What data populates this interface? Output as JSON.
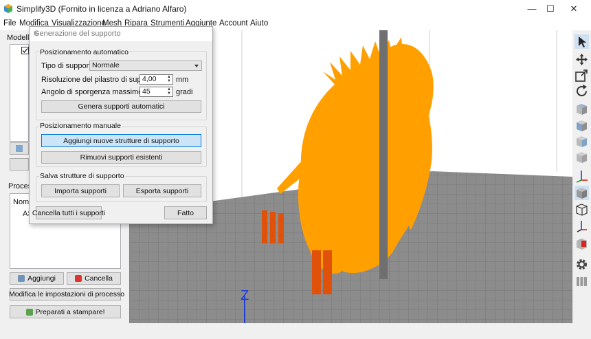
{
  "window": {
    "title": "Simplify3D (Fornito in licenza a Adriano Alfaro)",
    "minimize": "—",
    "maximize": "☐",
    "close": "✕"
  },
  "menu": [
    "File",
    "Modifica",
    "Visualizzazione",
    "Mesh",
    "Ripara",
    "Strumenti",
    "Aggiunte",
    "Account",
    "Aiuto"
  ],
  "left": {
    "models_label": "Modelli",
    "processes_label": "Processi",
    "process_list_header": "Nome",
    "process_item": "AS",
    "add_button": "Aggiungi",
    "delete_button": "Cancella",
    "edit_process_button": "Modifica le impostazioni di processo",
    "prepare_button": "Preparati a stampare!"
  },
  "dialog": {
    "title": "Generazione del supporto",
    "close": "×",
    "auto_group": "Posizionamento automatico",
    "support_type_label": "Tipo di supporto",
    "support_type_value": "Normale",
    "pillar_label": "Risoluzione del pilastro di supporto",
    "pillar_value": "4,00",
    "pillar_unit": "mm",
    "angle_label": "Angolo di sporgenza massimo",
    "angle_value": "45",
    "angle_unit": "gradi",
    "generate_button": "Genera supporti automatici",
    "manual_group": "Posizionamento manuale",
    "add_structures_button": "Aggiungi nuove strutture di supporto",
    "remove_button": "Rimuovi supporti esistenti",
    "save_group": "Salva strutture di supporto",
    "import_button": "Importa supporti",
    "export_button": "Esporta supporti",
    "cancel_all_button": "Cancella tutti i supporti",
    "done_button": "Fatto"
  },
  "viewport": {
    "axis_label": "Z",
    "model_color": "#ffa000",
    "support_color": "#e0520a",
    "bed_color": "#8c8c8c"
  },
  "toolbar_icons": [
    "select-arrow-icon",
    "move-icon",
    "scale-icon",
    "rotate-icon",
    "view-cube-top-icon",
    "view-cube-front-icon",
    "view-cube-side-icon",
    "view-cube-iso-icon",
    "axes-icon",
    "solid-view-icon",
    "wireframe-view-icon",
    "axis-toggle-icon",
    "cross-section-icon",
    "settings-gear-icon",
    "supports-icon"
  ]
}
